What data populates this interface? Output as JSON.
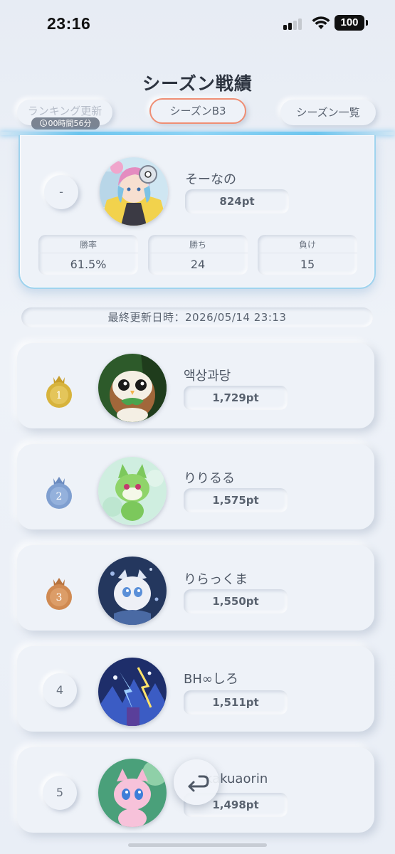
{
  "status_bar": {
    "time": "23:16",
    "battery": "100"
  },
  "header": {
    "title": "シーズン戦績",
    "ranking_update_label": "ランキング更新",
    "ranking_update_timer": "00時間56分",
    "season_label": "シーズンB3",
    "season_list_label": "シーズン一覧"
  },
  "my_record": {
    "rank": "-",
    "name": "そーなの",
    "points": "824pt",
    "stats": [
      {
        "label": "勝率",
        "value": "61.5%"
      },
      {
        "label": "勝ち",
        "value": "24"
      },
      {
        "label": "負け",
        "value": "15"
      }
    ]
  },
  "last_updated": "最終更新日時：2026/05/14 23:13",
  "rankings": [
    {
      "rank": "1",
      "name": "액상과당",
      "points": "1,729pt",
      "medal_color": "#d7b33c"
    },
    {
      "rank": "2",
      "name": "りりるる",
      "points": "1,575pt",
      "medal_color": "#7f9fd0"
    },
    {
      "rank": "3",
      "name": "りらっくま",
      "points": "1,550pt",
      "medal_color": "#d08a52"
    },
    {
      "rank": "4",
      "name": "BH∞しろ",
      "points": "1,511pt"
    },
    {
      "rank": "5",
      "name": "kakuaorin",
      "points": "1,498pt"
    }
  ]
}
